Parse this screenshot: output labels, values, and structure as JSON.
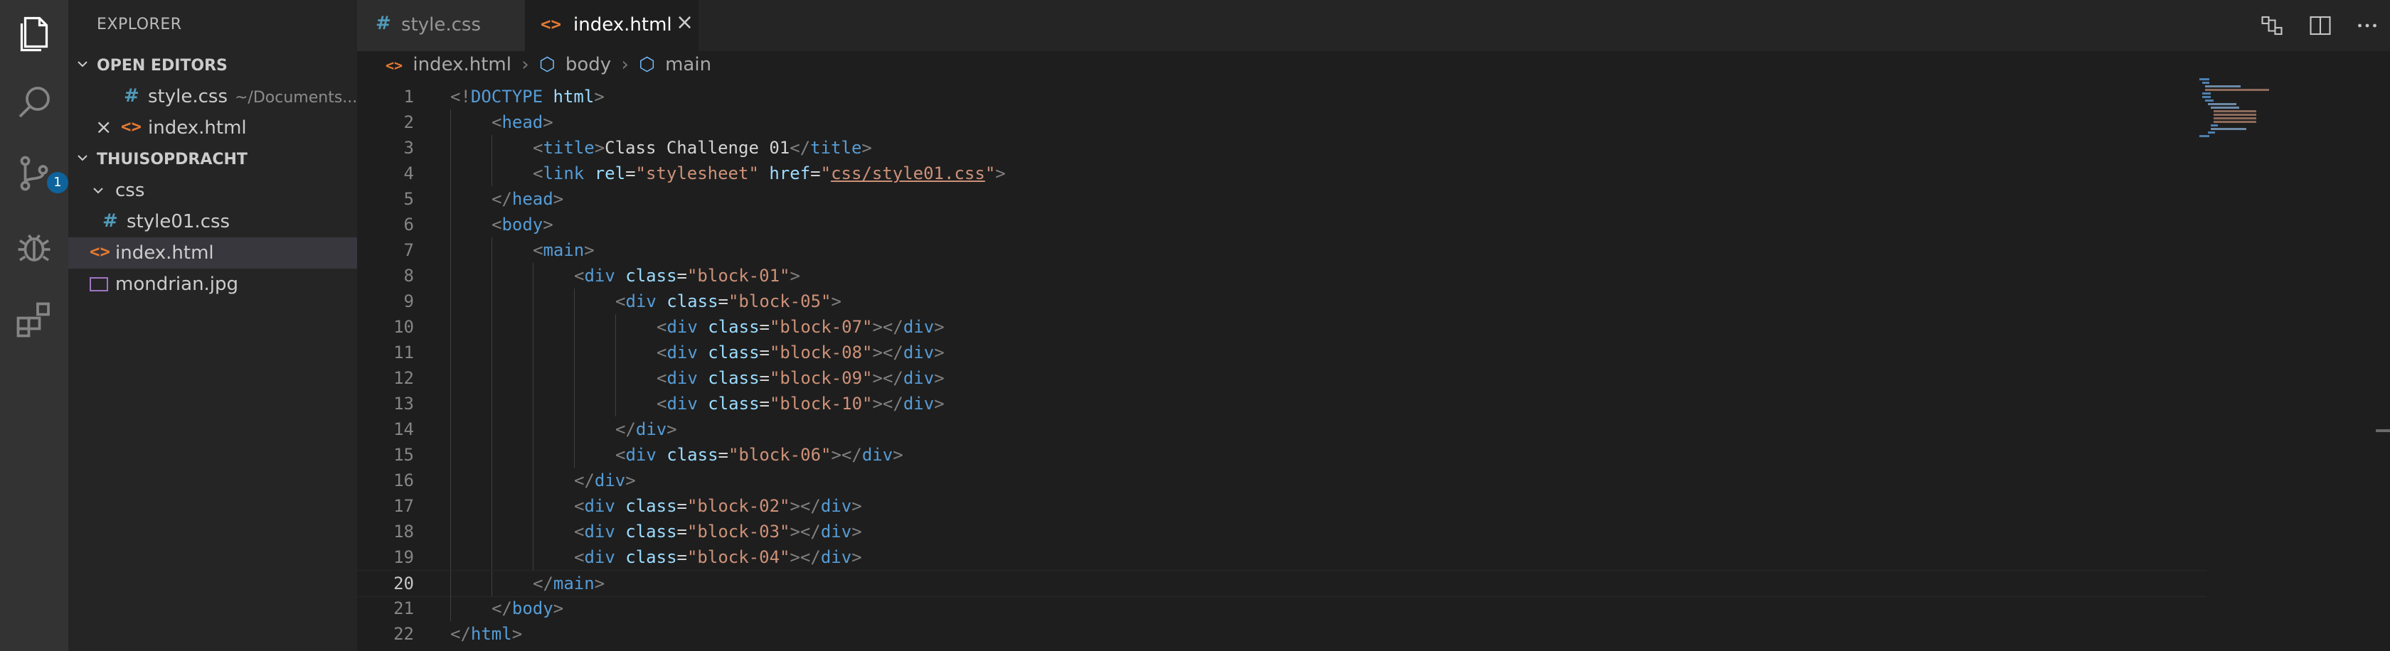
{
  "activity_bar": {
    "items": [
      {
        "name": "explorer-icon"
      },
      {
        "name": "search-icon"
      },
      {
        "name": "source-control-icon",
        "badge": "1"
      },
      {
        "name": "debug-icon"
      },
      {
        "name": "extensions-icon"
      }
    ]
  },
  "sidebar": {
    "title": "EXPLORER",
    "open_editors": {
      "label": "OPEN EDITORS",
      "items": [
        {
          "name": "style.css",
          "desc": "~/Documents..."
        },
        {
          "name": "index.html"
        }
      ]
    },
    "folder": {
      "label": "THUISOPDRACHT",
      "items": [
        {
          "name": "css"
        },
        {
          "name": "style01.css"
        },
        {
          "name": "index.html"
        },
        {
          "name": "mondrian.jpg"
        }
      ]
    }
  },
  "tabs": [
    {
      "label": "style.css",
      "active": false
    },
    {
      "label": "index.html",
      "active": true
    }
  ],
  "breadcrumb": [
    "index.html",
    "body",
    "main"
  ],
  "code": {
    "current_line": 20,
    "line_numbers": [
      "1",
      "2",
      "3",
      "4",
      "5",
      "6",
      "7",
      "8",
      "9",
      "10",
      "11",
      "12",
      "13",
      "14",
      "15",
      "16",
      "17",
      "18",
      "19",
      "20",
      "21",
      "22"
    ],
    "lines": [
      {
        "indent": 0,
        "tokens": [
          [
            "p",
            "<!"
          ],
          [
            "tg",
            "DOCTYPE"
          ],
          [
            "tx",
            " "
          ],
          [
            "at",
            "html"
          ],
          [
            "p",
            ">"
          ]
        ]
      },
      {
        "indent": 1,
        "tokens": [
          [
            "p",
            "<"
          ],
          [
            "tg",
            "head"
          ],
          [
            "p",
            ">"
          ]
        ]
      },
      {
        "indent": 2,
        "tokens": [
          [
            "p",
            "<"
          ],
          [
            "tg",
            "title"
          ],
          [
            "p",
            ">"
          ],
          [
            "tx",
            "Class Challenge 01"
          ],
          [
            "p",
            "</"
          ],
          [
            "tg",
            "title"
          ],
          [
            "p",
            ">"
          ]
        ]
      },
      {
        "indent": 2,
        "tokens": [
          [
            "p",
            "<"
          ],
          [
            "tg",
            "link"
          ],
          [
            "tx",
            " "
          ],
          [
            "at",
            "rel"
          ],
          [
            "tx",
            "="
          ],
          [
            "st",
            "\"stylesheet\""
          ],
          [
            "tx",
            " "
          ],
          [
            "at",
            "href"
          ],
          [
            "tx",
            "="
          ],
          [
            "st",
            "\""
          ],
          [
            "st ul",
            "css/style01.css"
          ],
          [
            "st",
            "\""
          ],
          [
            "p",
            ">"
          ]
        ]
      },
      {
        "indent": 1,
        "tokens": [
          [
            "p",
            "</"
          ],
          [
            "tg",
            "head"
          ],
          [
            "p",
            ">"
          ]
        ]
      },
      {
        "indent": 1,
        "tokens": [
          [
            "p",
            "<"
          ],
          [
            "tg",
            "body"
          ],
          [
            "p",
            ">"
          ]
        ]
      },
      {
        "indent": 2,
        "tokens": [
          [
            "p",
            "<"
          ],
          [
            "tg",
            "main"
          ],
          [
            "p",
            ">"
          ]
        ]
      },
      {
        "indent": 3,
        "tokens": [
          [
            "p",
            "<"
          ],
          [
            "tg",
            "div"
          ],
          [
            "tx",
            " "
          ],
          [
            "at",
            "class"
          ],
          [
            "tx",
            "="
          ],
          [
            "st",
            "\"block-01\""
          ],
          [
            "p",
            ">"
          ]
        ]
      },
      {
        "indent": 4,
        "tokens": [
          [
            "p",
            "<"
          ],
          [
            "tg",
            "div"
          ],
          [
            "tx",
            " "
          ],
          [
            "at",
            "class"
          ],
          [
            "tx",
            "="
          ],
          [
            "st",
            "\"block-05\""
          ],
          [
            "p",
            ">"
          ]
        ]
      },
      {
        "indent": 5,
        "tokens": [
          [
            "p",
            "<"
          ],
          [
            "tg",
            "div"
          ],
          [
            "tx",
            " "
          ],
          [
            "at",
            "class"
          ],
          [
            "tx",
            "="
          ],
          [
            "st",
            "\"block-07\""
          ],
          [
            "p",
            "></"
          ],
          [
            "tg",
            "div"
          ],
          [
            "p",
            ">"
          ]
        ]
      },
      {
        "indent": 5,
        "tokens": [
          [
            "p",
            "<"
          ],
          [
            "tg",
            "div"
          ],
          [
            "tx",
            " "
          ],
          [
            "at",
            "class"
          ],
          [
            "tx",
            "="
          ],
          [
            "st",
            "\"block-08\""
          ],
          [
            "p",
            "></"
          ],
          [
            "tg",
            "div"
          ],
          [
            "p",
            ">"
          ]
        ]
      },
      {
        "indent": 5,
        "tokens": [
          [
            "p",
            "<"
          ],
          [
            "tg",
            "div"
          ],
          [
            "tx",
            " "
          ],
          [
            "at",
            "class"
          ],
          [
            "tx",
            "="
          ],
          [
            "st",
            "\"block-09\""
          ],
          [
            "p",
            "></"
          ],
          [
            "tg",
            "div"
          ],
          [
            "p",
            ">"
          ]
        ]
      },
      {
        "indent": 5,
        "tokens": [
          [
            "p",
            "<"
          ],
          [
            "tg",
            "div"
          ],
          [
            "tx",
            " "
          ],
          [
            "at",
            "class"
          ],
          [
            "tx",
            "="
          ],
          [
            "st",
            "\"block-10\""
          ],
          [
            "p",
            "></"
          ],
          [
            "tg",
            "div"
          ],
          [
            "p",
            ">"
          ]
        ]
      },
      {
        "indent": 4,
        "tokens": [
          [
            "p",
            "</"
          ],
          [
            "tg",
            "div"
          ],
          [
            "p",
            ">"
          ]
        ]
      },
      {
        "indent": 4,
        "tokens": [
          [
            "p",
            "<"
          ],
          [
            "tg",
            "div"
          ],
          [
            "tx",
            " "
          ],
          [
            "at",
            "class"
          ],
          [
            "tx",
            "="
          ],
          [
            "st",
            "\"block-06\""
          ],
          [
            "p",
            "></"
          ],
          [
            "tg",
            "div"
          ],
          [
            "p",
            ">"
          ]
        ]
      },
      {
        "indent": 3,
        "tokens": [
          [
            "p",
            "</"
          ],
          [
            "tg",
            "div"
          ],
          [
            "p",
            ">"
          ]
        ]
      },
      {
        "indent": 3,
        "tokens": [
          [
            "p",
            "<"
          ],
          [
            "tg",
            "div"
          ],
          [
            "tx",
            " "
          ],
          [
            "at",
            "class"
          ],
          [
            "tx",
            "="
          ],
          [
            "st",
            "\"block-02\""
          ],
          [
            "p",
            "></"
          ],
          [
            "tg",
            "div"
          ],
          [
            "p",
            ">"
          ]
        ]
      },
      {
        "indent": 3,
        "tokens": [
          [
            "p",
            "<"
          ],
          [
            "tg",
            "div"
          ],
          [
            "tx",
            " "
          ],
          [
            "at",
            "class"
          ],
          [
            "tx",
            "="
          ],
          [
            "st",
            "\"block-03\""
          ],
          [
            "p",
            "></"
          ],
          [
            "tg",
            "div"
          ],
          [
            "p",
            ">"
          ]
        ]
      },
      {
        "indent": 3,
        "tokens": [
          [
            "p",
            "<"
          ],
          [
            "tg",
            "div"
          ],
          [
            "tx",
            " "
          ],
          [
            "at",
            "class"
          ],
          [
            "tx",
            "="
          ],
          [
            "st",
            "\"block-04\""
          ],
          [
            "p",
            "></"
          ],
          [
            "tg",
            "div"
          ],
          [
            "p",
            ">"
          ]
        ]
      },
      {
        "indent": 2,
        "tokens": [
          [
            "p",
            "</"
          ],
          [
            "tg",
            "main"
          ],
          [
            "p",
            ">"
          ]
        ]
      },
      {
        "indent": 1,
        "tokens": [
          [
            "p",
            "</"
          ],
          [
            "tg",
            "body"
          ],
          [
            "p",
            ">"
          ]
        ]
      },
      {
        "indent": 0,
        "tokens": [
          [
            "p",
            "</"
          ],
          [
            "tg",
            "html"
          ],
          [
            "p",
            ">"
          ]
        ]
      }
    ]
  },
  "colors": {
    "tag": "#569cd6",
    "attribute": "#9cdcfe",
    "string": "#ce9178",
    "punctuation": "#808080",
    "text": "#d4d4d4",
    "badge": "#0e639c"
  }
}
